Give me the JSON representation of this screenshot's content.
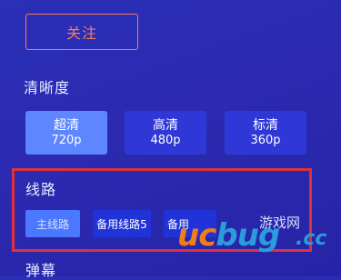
{
  "follow_button": {
    "label": "关注"
  },
  "clarity": {
    "title": "清晰度",
    "options": [
      {
        "name": "超清",
        "resolution": "720p",
        "selected": true
      },
      {
        "name": "高清",
        "resolution": "480p",
        "selected": false
      },
      {
        "name": "标清",
        "resolution": "360p",
        "selected": false
      }
    ]
  },
  "route": {
    "title": "线路",
    "options": [
      {
        "label": "主线路",
        "selected": true
      },
      {
        "label": "备用线路5",
        "selected": false
      },
      {
        "label": "备用",
        "selected": false
      }
    ]
  },
  "danmu": {
    "title": "弹幕"
  },
  "watermark": {
    "brand_left": "uc",
    "brand_right": "bug",
    "sub_text": "游戏网",
    "suffix": ".cc"
  },
  "colors": {
    "background": "#2a2fb8",
    "accent_orange": "#ff7b54",
    "selected_button": "#5e86ff",
    "normal_button": "#2f38d6",
    "highlight_red": "#e0313a"
  }
}
